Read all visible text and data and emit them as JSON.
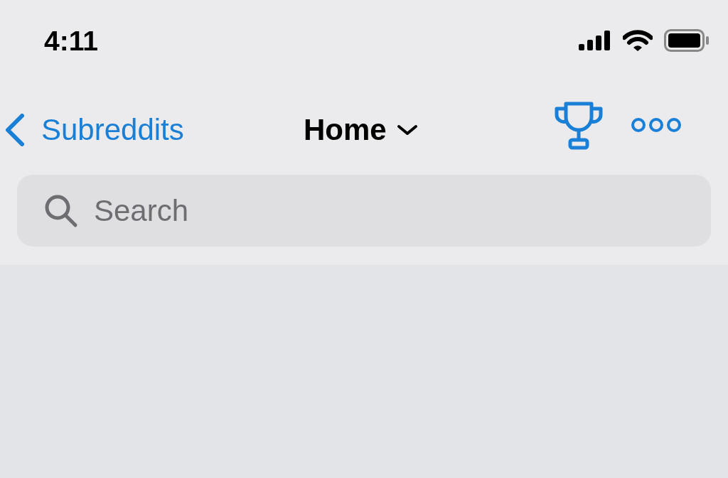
{
  "status_bar": {
    "time": "4:11"
  },
  "nav": {
    "back_label": "Subreddits",
    "title": "Home"
  },
  "search": {
    "placeholder": "Search"
  }
}
